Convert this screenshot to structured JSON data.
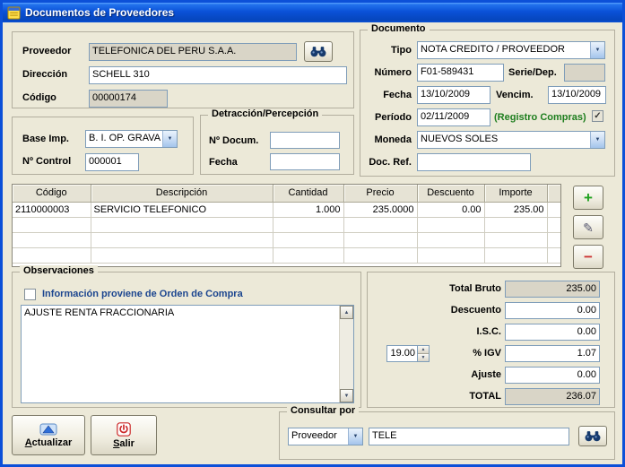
{
  "window": {
    "title": "Documentos de Proveedores"
  },
  "colors": {
    "titlebar": "#0a51d8",
    "window_bg": "#ece9d8",
    "readonly_bg": "#d9d5c7",
    "registro_green": "#1e7e1e"
  },
  "proveedor": {
    "proveedor_label": "Proveedor",
    "proveedor_value": "TELEFONICA DEL PERU S.A.A.",
    "direccion_label": "Dirección",
    "direccion_value": "SCHELL 310",
    "codigo_label": "Código",
    "codigo_value": "00000174"
  },
  "base_imp": {
    "base_label": "Base Imp.",
    "base_value": "B. I. OP. GRAVA",
    "control_label": "Nº Control",
    "control_value": "000001"
  },
  "detraccion": {
    "title": "Detracción/Percepción",
    "ndocum_label": "Nº Docum.",
    "ndocum_value": "",
    "fecha_label": "Fecha",
    "fecha_value": ""
  },
  "documento": {
    "title": "Documento",
    "tipo_label": "Tipo",
    "tipo_value": "NOTA CREDITO / PROVEEDOR",
    "numero_label": "Número",
    "numero_value": "F01-589431",
    "serie_label": "Serie/Dep.",
    "serie_value": "",
    "fecha_label": "Fecha",
    "fecha_value": "13/10/2009",
    "vencim_label": "Vencim.",
    "vencim_value": "13/10/2009",
    "periodo_label": "Período",
    "periodo_value": "02/11/2009",
    "registro_label": "(Registro Compras)",
    "registro_check": "✓",
    "moneda_label": "Moneda",
    "moneda_value": "NUEVOS SOLES",
    "docref_label": "Doc. Ref.",
    "docref_value": ""
  },
  "grid": {
    "headers": [
      "Código",
      "Descripción",
      "Cantidad",
      "Precio",
      "Descuento",
      "Importe"
    ],
    "rows": [
      [
        "2110000003",
        "SERVICIO TELEFONICO",
        "1.000",
        "235.0000",
        "0.00",
        "235.00"
      ]
    ]
  },
  "observaciones": {
    "title": "Observaciones",
    "checkbox_label": "Información proviene de Orden de Compra",
    "text": "AJUSTE RENTA FRACCIONARIA"
  },
  "totales": {
    "total_bruto_label": "Total Bruto",
    "total_bruto_value": "235.00",
    "descuento_label": "Descuento",
    "descuento_value": "0.00",
    "isc_label": "I.S.C.",
    "isc_value": "0.00",
    "igv_rate_value": "19.00",
    "igv_label": "% IGV",
    "igv_value": "1.07",
    "ajuste_label": "Ajuste",
    "ajuste_value": "0.00",
    "total_label": "TOTAL",
    "total_value": "236.07"
  },
  "footer": {
    "actualizar_label": "Actualizar",
    "salir_label": "Salir",
    "consultar_title": "Consultar por",
    "consultar_tipo_value": "Proveedor",
    "consultar_text_value": "TELE"
  }
}
